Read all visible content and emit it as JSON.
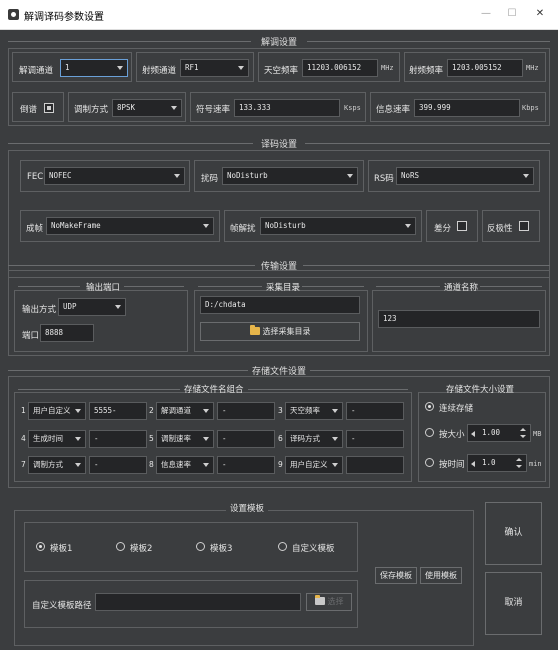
{
  "window": {
    "title": "解调译码参数设置",
    "minimize": "—",
    "maximize": "☐",
    "close": "✕"
  },
  "demod": {
    "title": "解调设置",
    "channel_label": "解调通道",
    "channel_value": "1",
    "rf_channel_label": "射频通道",
    "rf_channel_value": "RF1",
    "sky_freq_label": "天空频率",
    "sky_freq_value": "11203.006152",
    "sky_freq_unit": "MHz",
    "rf_freq_label": "射频频率",
    "rf_freq_value": "1203.005152",
    "rf_freq_unit": "MHz",
    "inverse_label": "倒谱",
    "mod_label": "调制方式",
    "mod_value": "8PSK",
    "symbol_label": "符号速率",
    "symbol_value": "133.333",
    "symbol_unit": "Ksps",
    "info_label": "信息速率",
    "info_value": "399.999",
    "info_unit": "Kbps"
  },
  "decode": {
    "title": "译码设置",
    "fec_label": "FEC",
    "fec_value": "NOFEC",
    "scramble_label": "扰码",
    "scramble_value": "NoDisturb",
    "rs_label": "RS码",
    "rs_value": "NoRS",
    "frame_label": "成帧",
    "frame_value": "NoMakeFrame",
    "descramble_label": "帧解扰",
    "descramble_value": "NoDisturb",
    "diff_label": "差分",
    "polarity_label": "反极性"
  },
  "transfer": {
    "title": "传输设置",
    "port_group": "输出端口",
    "out_mode_label": "输出方式",
    "out_mode_value": "UDP",
    "port_label": "端口",
    "port_value": "8888",
    "collect_group": "采集目录",
    "collect_path": "D:/chdata",
    "collect_button": "选择采集目录",
    "channel_name_group": "通道名称",
    "channel_name_value": "123"
  },
  "storage": {
    "title": "存储文件设置",
    "name_group": "存储文件名组合",
    "items": [
      {
        "num": "1",
        "option": "用户自定义",
        "value": "5555-"
      },
      {
        "num": "2",
        "option": "解调通道",
        "value": "-"
      },
      {
        "num": "3",
        "option": "天空频率",
        "value": "-"
      },
      {
        "num": "4",
        "option": "生成时间",
        "value": "-"
      },
      {
        "num": "5",
        "option": "调制速率",
        "value": "-"
      },
      {
        "num": "6",
        "option": "译码方式",
        "value": "-"
      },
      {
        "num": "7",
        "option": "调制方式",
        "value": "-"
      },
      {
        "num": "8",
        "option": "信息速率",
        "value": "-"
      },
      {
        "num": "9",
        "option": "用户自定义",
        "value": ""
      }
    ],
    "size_group": "存储文件大小设置",
    "continuous_label": "连续存储",
    "by_size_label": "按大小",
    "by_size_value": "1.00",
    "by_size_unit": "MB",
    "by_time_label": "按时间",
    "by_time_value": "1.0",
    "by_time_unit": "min"
  },
  "template": {
    "title": "设置模板",
    "options": [
      "模板1",
      "模板2",
      "模板3",
      "自定义模板"
    ],
    "path_label": "自定义模板路径",
    "path_value": "",
    "browse_label": "选择",
    "save_button": "保存模板",
    "use_button": "使用模板"
  },
  "actions": {
    "confirm": "确认",
    "cancel": "取消"
  }
}
